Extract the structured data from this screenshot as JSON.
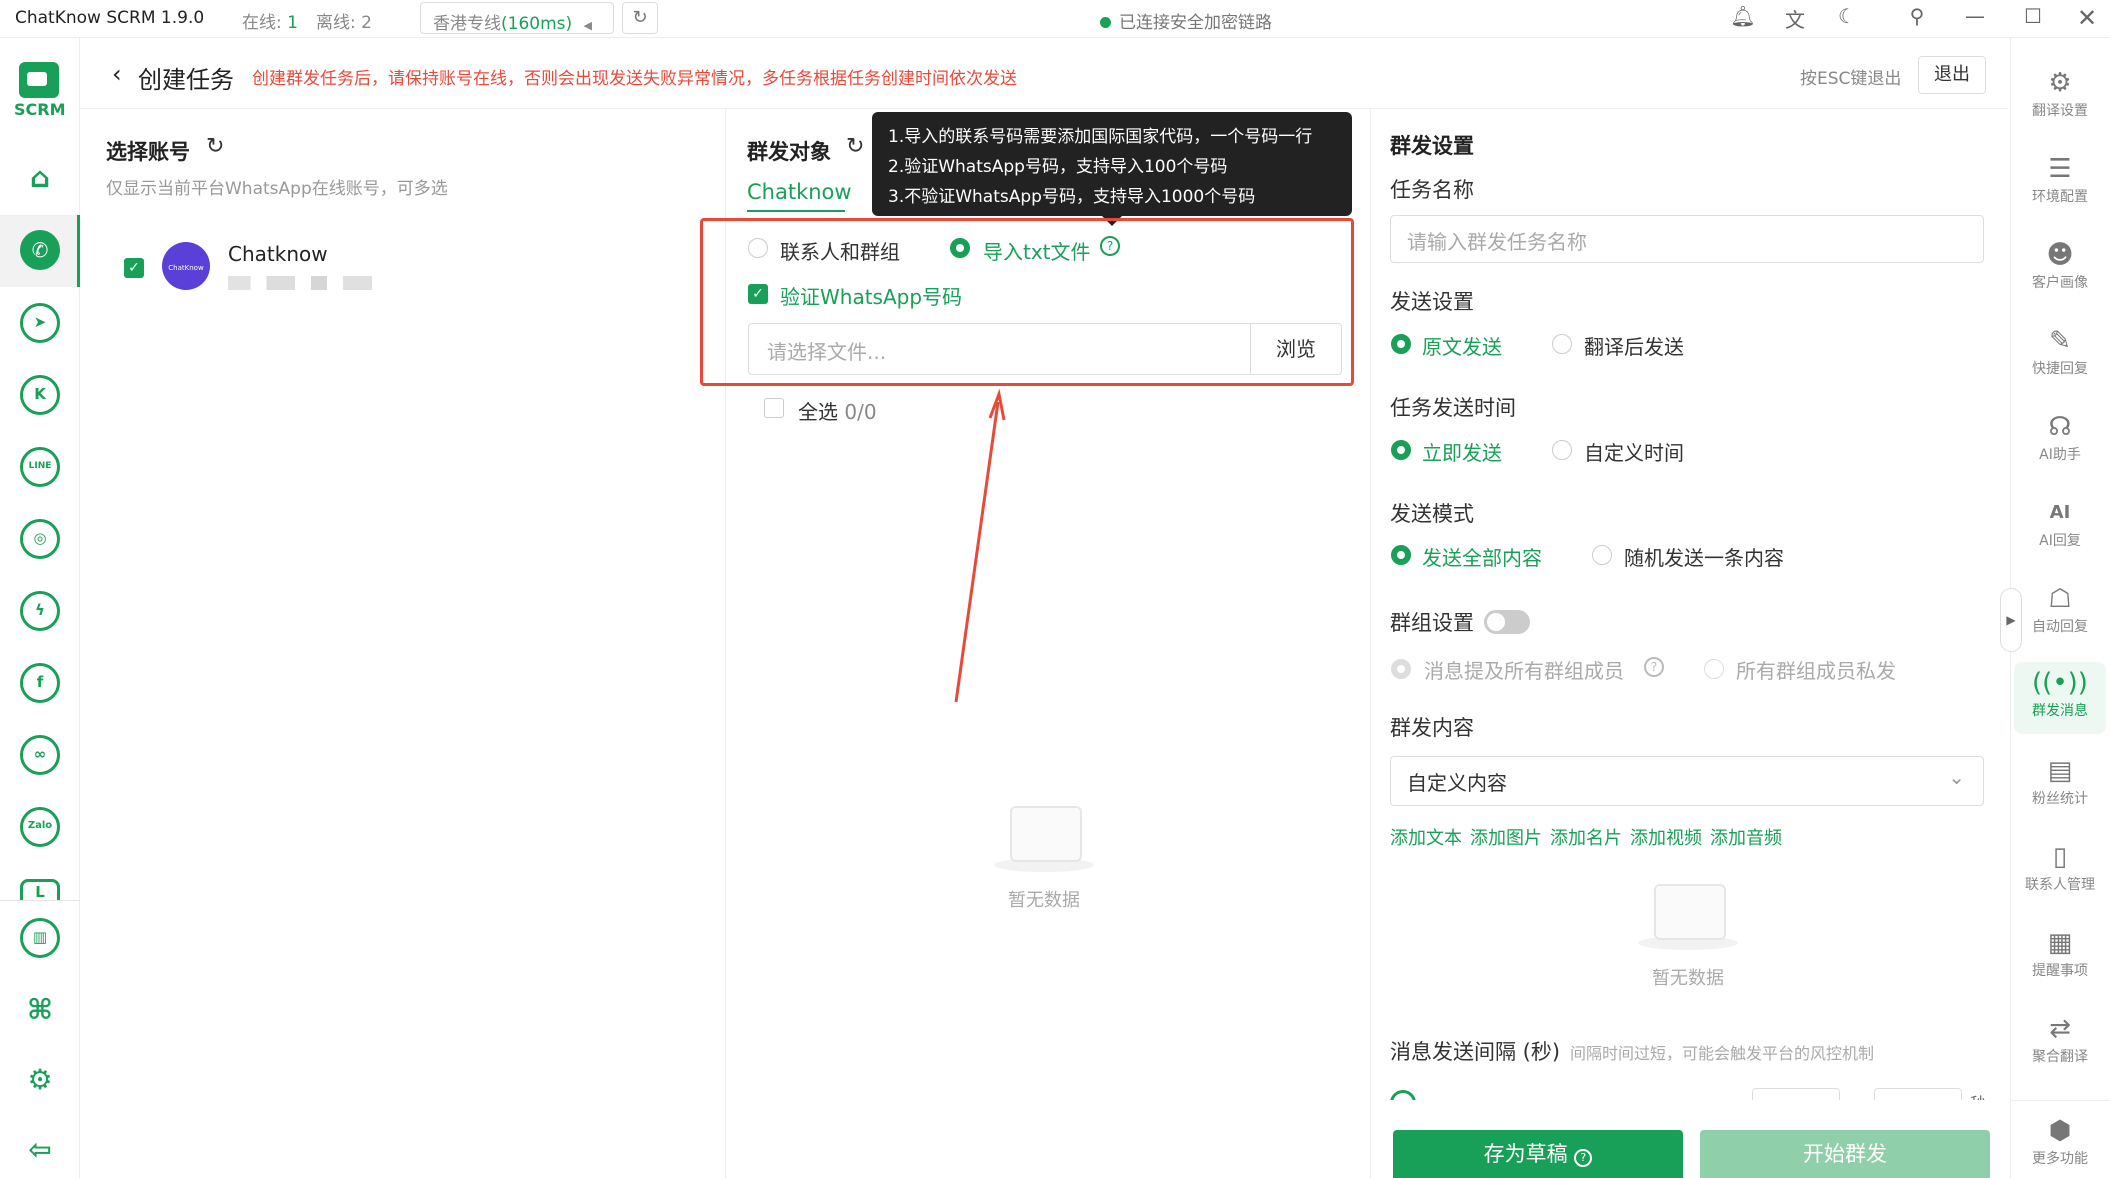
{
  "titlebar": {
    "app": "ChatKnow SCRM 1.9.0",
    "online_label": "在线:",
    "online_count": "1",
    "offline_label": "离线:",
    "offline_count": "2",
    "proxy_name": "香港专线",
    "proxy_latency": "(160ms)",
    "connection": "已连接安全加密链路"
  },
  "brand": {
    "logo_text": "SCRM",
    "accent": "#18a058",
    "warn": "#e84a3a"
  },
  "rail": {
    "icons": [
      "home-icon",
      "whatsapp-icon",
      "telegram-icon",
      "telegram-k-icon",
      "line-icon",
      "instagram-icon",
      "messenger-icon",
      "facebook-icon",
      "meta-icon",
      "zalo-icon",
      "line-works-icon",
      "stats-icon",
      "apps-icon",
      "settings-icon",
      "logout-icon"
    ],
    "line_text": "LINE",
    "zalo_text": "Zalo"
  },
  "header": {
    "title": "创建任务",
    "warning": "创建群发任务后，请保持账号在线，否则会出现发送失败异常情况，多任务根据任务创建时间依次发送",
    "esc_hint": "按ESC键退出",
    "exit": "退出"
  },
  "accounts": {
    "title": "选择账号",
    "subtitle": "仅显示当前平台WhatsApp在线账号，可多选",
    "items": [
      {
        "name": "Chatknow",
        "avatar_text": "ChatKnow",
        "checked": true
      }
    ]
  },
  "targets": {
    "title": "群发对象",
    "tab": "Chatknow",
    "opt_contacts": "联系人和群组",
    "opt_import": "导入txt文件",
    "verify": "验证WhatsApp号码",
    "file_placeholder": "请选择文件...",
    "browse": "浏览",
    "select_all": "全选",
    "count": "0/0",
    "empty": "暂无数据",
    "tooltip": [
      "1.导入的联系号码需要添加国际国家代码，一个号码一行",
      "2.验证WhatsApp号码，支持导入100个号码",
      "3.不验证WhatsApp号码，支持导入1000个号码"
    ]
  },
  "settings": {
    "title": "群发设置",
    "task_name_label": "任务名称",
    "task_name_placeholder": "请输入群发任务名称",
    "send_label": "发送设置",
    "send_original": "原文发送",
    "send_translated": "翻译后发送",
    "time_label": "任务发送时间",
    "time_now": "立即发送",
    "time_custom": "自定义时间",
    "mode_label": "发送模式",
    "mode_all": "发送全部内容",
    "mode_random": "随机发送一条内容",
    "group_label": "群组设置",
    "group_mention": "消息提及所有群组成员",
    "group_private": "所有群组成员私发",
    "content_label": "群发内容",
    "content_select": "自定义内容",
    "add_links": [
      "添加文本",
      "添加图片",
      "添加名片",
      "添加视频",
      "添加音频"
    ],
    "empty": "暂无数据",
    "interval_label": "消息发送间隔 (秒)",
    "interval_hint": "间隔时间过短，可能会触发平台的风控机制",
    "interval_unit": "秒",
    "draft": "存为草稿",
    "start": "开始群发"
  },
  "right_rail": [
    {
      "label": "翻译设置",
      "icon": "translate-settings-icon"
    },
    {
      "label": "环境配置",
      "icon": "env-config-icon"
    },
    {
      "label": "客户画像",
      "icon": "customer-profile-icon"
    },
    {
      "label": "快捷回复",
      "icon": "quick-reply-icon"
    },
    {
      "label": "AI助手",
      "icon": "ai-assistant-icon"
    },
    {
      "label": "AI回复",
      "icon": "ai-reply-icon"
    },
    {
      "label": "自动回复",
      "icon": "auto-reply-icon"
    },
    {
      "label": "群发消息",
      "icon": "broadcast-icon",
      "active": true
    },
    {
      "label": "粉丝统计",
      "icon": "fans-stats-icon"
    },
    {
      "label": "联系人管理",
      "icon": "contacts-icon"
    },
    {
      "label": "提醒事项",
      "icon": "reminder-icon"
    },
    {
      "label": "聚合翻译",
      "icon": "aggregate-translate-icon"
    },
    {
      "label": "更多功能",
      "icon": "more-icon"
    }
  ],
  "right_rail_glyphs": {
    "ai": "AI"
  }
}
